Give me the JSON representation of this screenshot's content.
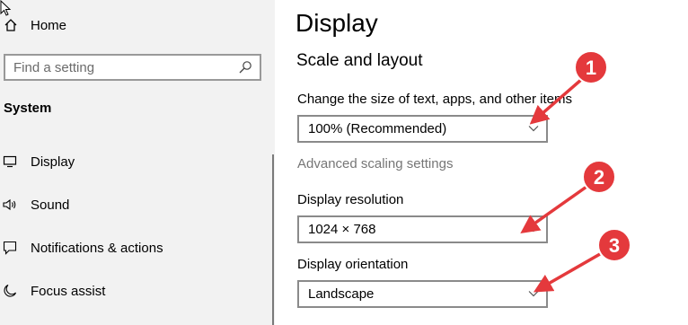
{
  "sidebar": {
    "home_label": "Home",
    "search_placeholder": "Find a setting",
    "section_title": "System",
    "items": [
      {
        "label": "Display",
        "icon": "monitor-icon"
      },
      {
        "label": "Sound",
        "icon": "speaker-icon"
      },
      {
        "label": "Notifications & actions",
        "icon": "notification-icon"
      },
      {
        "label": "Focus assist",
        "icon": "moon-icon"
      }
    ]
  },
  "main": {
    "title": "Display",
    "subheading": "Scale and layout",
    "scale": {
      "label": "Change the size of text, apps, and other items",
      "value": "100% (Recommended)"
    },
    "advanced_link": "Advanced scaling settings",
    "resolution": {
      "label": "Display resolution",
      "value": "1024 × 768"
    },
    "orientation": {
      "label": "Display orientation",
      "value": "Landscape"
    }
  },
  "annotations": {
    "badges": [
      "1",
      "2",
      "3"
    ],
    "color": "#e4393c"
  },
  "colors": {
    "sidebar_bg": "#f2f2f2",
    "link_gray": "#767676",
    "annotation_red": "#e4393c"
  }
}
